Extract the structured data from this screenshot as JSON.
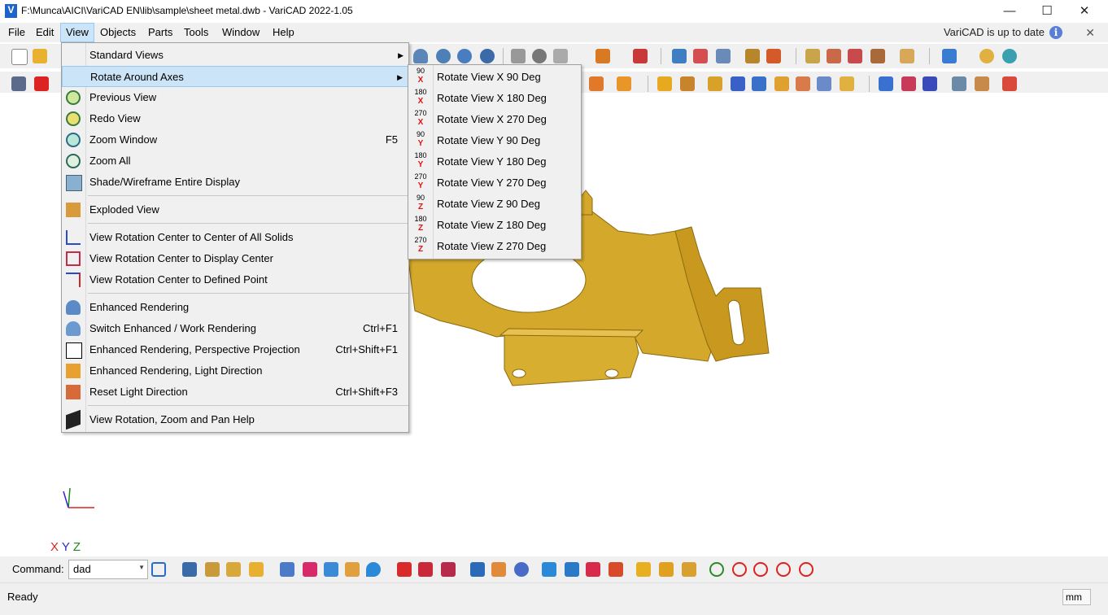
{
  "window": {
    "title": "F:\\Munca\\AICI\\VariCAD EN\\lib\\sample\\sheet metal.dwb - VariCAD 2022-1.05",
    "app_icon_letter": "V",
    "minimize": "—",
    "maximize": "☐",
    "close": "✕"
  },
  "menubar": {
    "items": [
      "File",
      "Edit",
      "View",
      "Objects",
      "Parts",
      "Tools",
      "Window",
      "Help"
    ],
    "active": "View",
    "update_text": "VariCAD is up to date",
    "info_glyph": "i",
    "close_glyph": "✕"
  },
  "view_menu": {
    "items": [
      {
        "label": "Standard Views",
        "shortcut": "",
        "submenu": true,
        "icon": "none"
      },
      {
        "label": "Rotate Around Axes",
        "shortcut": "",
        "submenu": true,
        "icon": "none",
        "highlighted": true
      },
      {
        "label": "Previous View",
        "shortcut": "",
        "icon": "previous-view-icon"
      },
      {
        "label": "Redo View",
        "shortcut": "",
        "icon": "redo-view-icon"
      },
      {
        "label": "Zoom Window",
        "shortcut": "F5",
        "icon": "zoom-window-icon"
      },
      {
        "label": "Zoom All",
        "shortcut": "",
        "icon": "zoom-all-icon"
      },
      {
        "label": "Shade/Wireframe Entire Display",
        "shortcut": "",
        "icon": "shade-wireframe-icon"
      },
      {
        "label": "Exploded View",
        "shortcut": "",
        "icon": "exploded-view-icon"
      },
      {
        "label": "View Rotation Center to Center of All Solids",
        "shortcut": "",
        "icon": "rotation-center-solids-icon"
      },
      {
        "label": "View Rotation Center to Display Center",
        "shortcut": "",
        "icon": "rotation-center-display-icon"
      },
      {
        "label": "View Rotation Center to Defined Point",
        "shortcut": "",
        "icon": "rotation-center-point-icon"
      },
      {
        "label": "Enhanced Rendering",
        "shortcut": "",
        "icon": "enhanced-rendering-icon"
      },
      {
        "label": "Switch Enhanced / Work Rendering",
        "shortcut": "Ctrl+F1",
        "icon": "switch-rendering-icon"
      },
      {
        "label": "Enhanced Rendering, Perspective Projection",
        "shortcut": "Ctrl+Shift+F1",
        "icon": "perspective-icon"
      },
      {
        "label": "Enhanced Rendering, Light Direction",
        "shortcut": "",
        "icon": "light-direction-icon"
      },
      {
        "label": "Reset Light Direction",
        "shortcut": "Ctrl+Shift+F3",
        "icon": "reset-light-icon"
      },
      {
        "label": "View Rotation, Zoom and Pan Help",
        "shortcut": "",
        "icon": "help-book-icon"
      }
    ]
  },
  "rotate_submenu": {
    "items": [
      {
        "label": "Rotate View X 90 Deg",
        "deg": "90",
        "axis": "X"
      },
      {
        "label": "Rotate View X 180 Deg",
        "deg": "180",
        "axis": "X"
      },
      {
        "label": "Rotate View X 270 Deg",
        "deg": "270",
        "axis": "X"
      },
      {
        "label": "Rotate View Y 90 Deg",
        "deg": "90",
        "axis": "Y"
      },
      {
        "label": "Rotate View Y 180 Deg",
        "deg": "180",
        "axis": "Y"
      },
      {
        "label": "Rotate View Y 270 Deg",
        "deg": "270",
        "axis": "Y"
      },
      {
        "label": "Rotate View Z 90 Deg",
        "deg": "90",
        "axis": "Z"
      },
      {
        "label": "Rotate View Z 180 Deg",
        "deg": "180",
        "axis": "Z"
      },
      {
        "label": "Rotate View Z 270 Deg",
        "deg": "270",
        "axis": "Z"
      }
    ]
  },
  "axis_indicator": {
    "x": "X",
    "y": "Y",
    "z": "Z"
  },
  "command": {
    "label": "Command:",
    "value": "dad"
  },
  "status": {
    "text": "Ready",
    "units": "mm"
  },
  "colors": {
    "part": "#d4a82a",
    "part_dark": "#a8801a",
    "highlight": "#cce4f7",
    "highlight_border": "#99c9ef",
    "menu_bg": "#f0f0f0"
  }
}
